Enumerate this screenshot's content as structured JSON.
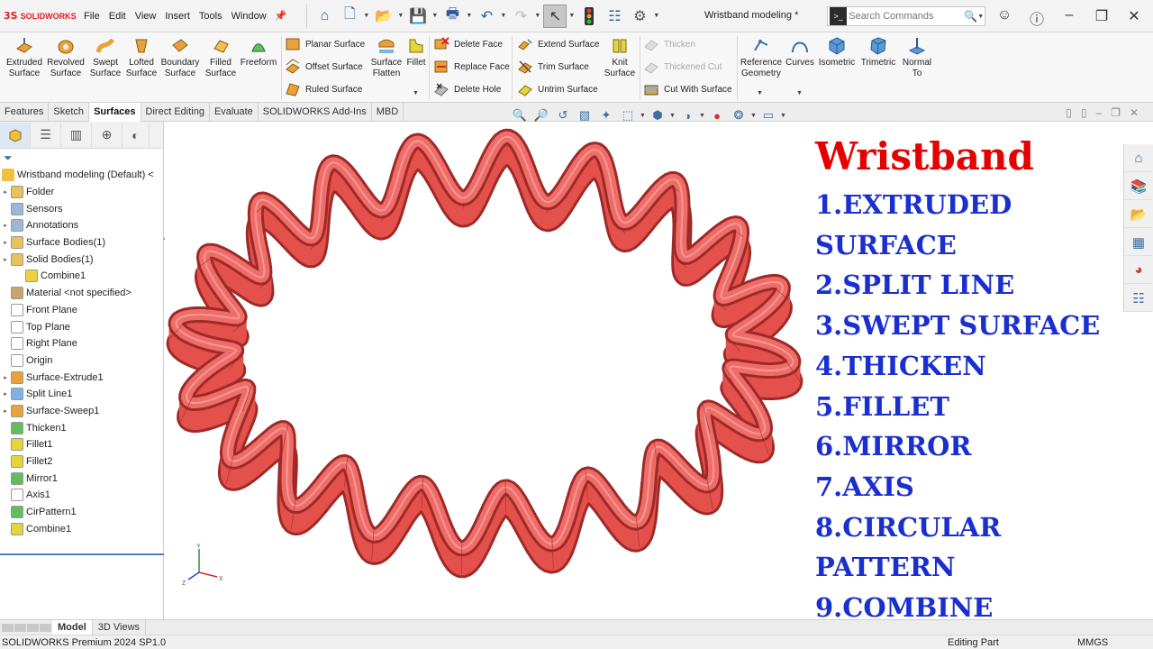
{
  "app": {
    "brand_ds": "3S",
    "brand_name": "SOLIDWORKS",
    "document_title": "Wristband modeling *",
    "search_placeholder": "Search Commands"
  },
  "menu": [
    "File",
    "Edit",
    "View",
    "Insert",
    "Tools",
    "Window"
  ],
  "command_manager": {
    "big_tools": [
      {
        "label": "Extruded\nSurface"
      },
      {
        "label": "Revolved\nSurface"
      },
      {
        "label": "Swept\nSurface"
      },
      {
        "label": "Lofted\nSurface"
      },
      {
        "label": "Boundary\nSurface"
      },
      {
        "label": "Filled\nSurface"
      },
      {
        "label": "Freeform"
      }
    ],
    "col1": [
      "Planar Surface",
      "Offset Surface",
      "Ruled Surface"
    ],
    "flatten_label": "Surface\nFlatten",
    "fillet_label": "Fillet",
    "col2": [
      "Delete Face",
      "Replace Face",
      "Delete Hole"
    ],
    "col3": [
      "Extend Surface",
      "Trim Surface",
      "Untrim Surface"
    ],
    "knit_label": "Knit\nSurface",
    "col4": [
      {
        "label": "Thicken",
        "disabled": true
      },
      {
        "label": "Thickened Cut",
        "disabled": true
      },
      {
        "label": "Cut With Surface",
        "disabled": false
      }
    ],
    "right_tools": [
      {
        "label": "Reference\nGeometry"
      },
      {
        "label": "Curves"
      },
      {
        "label": "Isometric"
      },
      {
        "label": "Trimetric"
      },
      {
        "label": "Normal\nTo"
      }
    ]
  },
  "tabs": [
    {
      "label": "Features",
      "active": false
    },
    {
      "label": "Sketch",
      "active": false
    },
    {
      "label": "Surfaces",
      "active": true
    },
    {
      "label": "Direct Editing",
      "active": false
    },
    {
      "label": "Evaluate",
      "active": false
    },
    {
      "label": "SOLIDWORKS Add-Ins",
      "active": false
    },
    {
      "label": "MBD",
      "active": false
    }
  ],
  "feature_tree": {
    "root": "Wristband modeling  (Default) <",
    "items": [
      {
        "label": "Folder",
        "icon": "folder-icon",
        "expandable": true,
        "indent": 0,
        "color": "#e8c25a"
      },
      {
        "label": "Sensors",
        "icon": "sensor-icon",
        "expandable": false,
        "indent": 0,
        "color": "#9db7d6"
      },
      {
        "label": "Annotations",
        "icon": "annotation-icon",
        "expandable": true,
        "indent": 0,
        "color": "#9db7d6"
      },
      {
        "label": "Surface Bodies(1)",
        "icon": "surface-body-icon",
        "expandable": true,
        "indent": 0,
        "color": "#e8c25a"
      },
      {
        "label": "Solid Bodies(1)",
        "icon": "solid-body-icon",
        "expandable": true,
        "indent": 0,
        "color": "#e8c25a"
      },
      {
        "label": "Combine1",
        "icon": "combine-icon",
        "expandable": false,
        "indent": 1,
        "color": "#f0d040"
      },
      {
        "label": "Material <not specified>",
        "icon": "material-icon",
        "expandable": false,
        "indent": 0,
        "color": "#c8a66a"
      },
      {
        "label": "Front Plane",
        "icon": "plane-icon",
        "expandable": false,
        "indent": 0,
        "color": "#ffffff"
      },
      {
        "label": "Top Plane",
        "icon": "plane-icon",
        "expandable": false,
        "indent": 0,
        "color": "#ffffff"
      },
      {
        "label": "Right Plane",
        "icon": "plane-icon",
        "expandable": false,
        "indent": 0,
        "color": "#ffffff"
      },
      {
        "label": "Origin",
        "icon": "origin-icon",
        "expandable": false,
        "indent": 0,
        "color": "#ffffff"
      },
      {
        "label": "Surface-Extrude1",
        "icon": "surface-extrude-icon",
        "expandable": true,
        "indent": 0,
        "color": "#e9a23b"
      },
      {
        "label": "Split Line1",
        "icon": "split-line-icon",
        "expandable": true,
        "indent": 0,
        "color": "#7fb2e0"
      },
      {
        "label": "Surface-Sweep1",
        "icon": "surface-sweep-icon",
        "expandable": true,
        "indent": 0,
        "color": "#e9a23b"
      },
      {
        "label": "Thicken1",
        "icon": "thicken-icon",
        "expandable": false,
        "indent": 0,
        "color": "#5fbf5f"
      },
      {
        "label": "Fillet1",
        "icon": "fillet-icon",
        "expandable": false,
        "indent": 0,
        "color": "#e6d43a"
      },
      {
        "label": "Fillet2",
        "icon": "fillet-icon",
        "expandable": false,
        "indent": 0,
        "color": "#e6d43a"
      },
      {
        "label": "Mirror1",
        "icon": "mirror-icon",
        "expandable": false,
        "indent": 0,
        "color": "#5fbf5f"
      },
      {
        "label": "Axis1",
        "icon": "axis-icon",
        "expandable": false,
        "indent": 0,
        "color": "#ffffff"
      },
      {
        "label": "CirPattern1",
        "icon": "circular-pattern-icon",
        "expandable": false,
        "indent": 0,
        "color": "#5fbf5f"
      },
      {
        "label": "Combine1",
        "icon": "combine-icon",
        "expandable": false,
        "indent": 0,
        "color": "#e6d43a"
      }
    ]
  },
  "tutorial": {
    "title": "Wristband",
    "steps": [
      "1.EXTRUDED",
      "SURFACE",
      "2.SPLIT LINE",
      "3.SWEPT SURFACE",
      "4.THICKEN",
      "5.FILLET",
      "6.MIRROR",
      "7.AXIS",
      "8.CIRCULAR",
      "PATTERN",
      "9.COMBINE"
    ]
  },
  "triad": {
    "x": "X",
    "y": "Y",
    "z": "Z"
  },
  "bottom_tabs": [
    {
      "label": "Model",
      "active": true
    },
    {
      "label": "3D Views",
      "active": false
    }
  ],
  "status": {
    "product": "SOLIDWORKS Premium 2024 SP1.0",
    "mode": "Editing Part",
    "units": "MMGS"
  },
  "colors": {
    "band": "#e4514c",
    "band_dark": "#9e2a27",
    "title_red": "#e60000",
    "steps_blue": "#1a2fd0",
    "brand_red": "#da2128"
  }
}
